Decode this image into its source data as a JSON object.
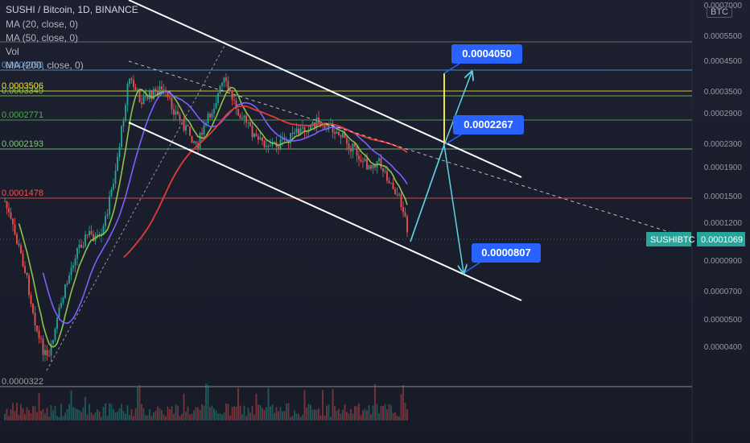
{
  "header": {
    "title": "SUSHI / Bitcoin, 1D, BINANCE",
    "indicator_1": "MA (20, close, 0)",
    "indicator_2": "MA (50, close, 0)",
    "indicator_3": "Vol",
    "indicator_4": "MA (200, close, 0)"
  },
  "currency_label": "BTC",
  "symbol_badge": {
    "symbol": "SUSHIBTC",
    "price": "0.0001069",
    "color": "#26a69a"
  },
  "chart_data": {
    "type": "candlestick",
    "title": "SUSHI / Bitcoin, 1D, BINANCE",
    "y_axis": {
      "ticks": [
        "0.0007000",
        "0.0005500",
        "0.0004500",
        "0.0003500",
        "0.0002900",
        "0.0002300",
        "0.0001900",
        "0.0001500",
        "0.0001200",
        "0.0000900",
        "0.0000700",
        "0.0000500",
        "0.0000400"
      ]
    },
    "fib_levels": [
      {
        "label": "0.0004050",
        "value": 0.000405,
        "color": "#5b9bd5"
      },
      {
        "label": "0.0003506",
        "value": 0.0003506,
        "color": "#f5e23b"
      },
      {
        "label": "0.0003349",
        "value": 0.0003349,
        "color": "#8bc34a"
      },
      {
        "label": "0.0002771",
        "value": 0.0002771,
        "color": "#4caf50"
      },
      {
        "label": "0.0002193",
        "value": 0.0002193,
        "color": "#81c784"
      },
      {
        "label": "0.0001478",
        "value": 0.0001478,
        "color": "#ef5350"
      },
      {
        "label": "0.0000322",
        "value": 3.22e-05,
        "color": "#9e9e9e"
      }
    ],
    "price_close": 0.0001069,
    "annotations": [
      {
        "label": "0.0004050",
        "value": 0.000405
      },
      {
        "label": "0.0002267",
        "value": 0.0002267
      },
      {
        "label": "0.0000807",
        "value": 8.07e-05
      }
    ],
    "colors": {
      "ma20": "#8bc34a",
      "ma50": "#7b61ff",
      "ma200": "#e53935",
      "up": "#26a69a",
      "down": "#ef5350",
      "channel": "#ffffff",
      "projection": "#5fd3e6",
      "target": "#f5e23b",
      "callout": "#2962ff"
    }
  }
}
